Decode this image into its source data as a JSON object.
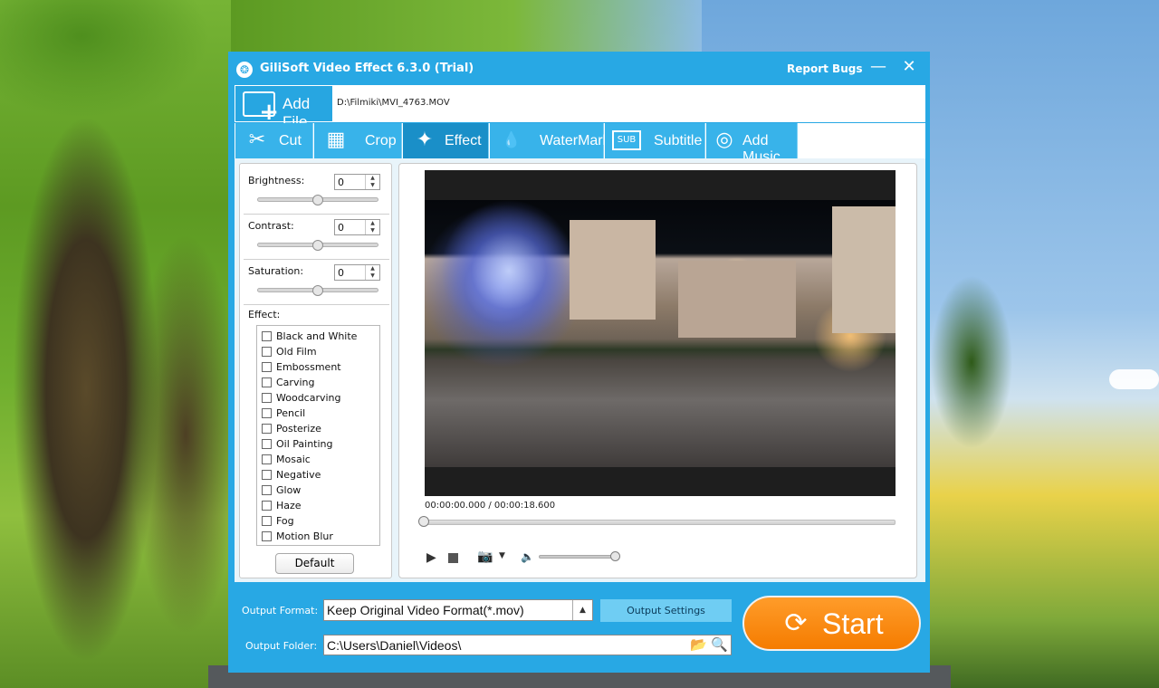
{
  "window": {
    "title": "GiliSoft Video Effect 6.3.0 (Trial)",
    "report_bugs": "Report Bugs",
    "minimize_glyph": "—",
    "close_glyph": "✕"
  },
  "file": {
    "add_file_label": "Add File",
    "path": "D:\\Filmiki\\MVI_4763.MOV"
  },
  "tabs": [
    {
      "label": "Cut",
      "icon": "scissors-icon",
      "glyph": "✂"
    },
    {
      "label": "Crop",
      "icon": "crop-icon",
      "glyph": "▦"
    },
    {
      "label": "Effect",
      "icon": "stars-icon",
      "glyph": "✦",
      "active": true
    },
    {
      "label": "WaterMark",
      "icon": "droplet-icon",
      "glyph": "💧"
    },
    {
      "label": "Subtitle",
      "icon": "sub-icon",
      "glyph": "SUB"
    },
    {
      "label": "Add Music",
      "icon": "speaker-icon",
      "glyph": "◎"
    }
  ],
  "adjust": {
    "brightness": {
      "label": "Brightness:",
      "value": "0",
      "slider_level": 0.5
    },
    "contrast": {
      "label": "Contrast:",
      "value": "0",
      "slider_level": 0.5
    },
    "saturation": {
      "label": "Saturation:",
      "value": "0",
      "slider_level": 0.5
    }
  },
  "effects": {
    "label": "Effect:",
    "items": [
      "Black and White",
      "Old Film",
      "Embossment",
      "Carving",
      "Woodcarving",
      "Pencil",
      "Posterize",
      "Oil Painting",
      "Mosaic",
      "Negative",
      "Glow",
      "Haze",
      "Fog",
      "Motion Blur"
    ],
    "default_button": "Default"
  },
  "player": {
    "timecode": "00:00:00.000 / 00:00:18.600",
    "seek_position": 0,
    "volume_level": 1.0
  },
  "output": {
    "format_label": "Output Format:",
    "format_value": "Keep Original Video Format(*.mov)",
    "settings_button": "Output Settings",
    "folder_label": "Output Folder:",
    "folder_value": "C:\\Users\\Daniel\\Videos\\",
    "start_label": "Start"
  },
  "colors": {
    "window_blue": "#28a8e4",
    "tab_active": "#1a8fc8",
    "start_orange": "#f57c00"
  }
}
